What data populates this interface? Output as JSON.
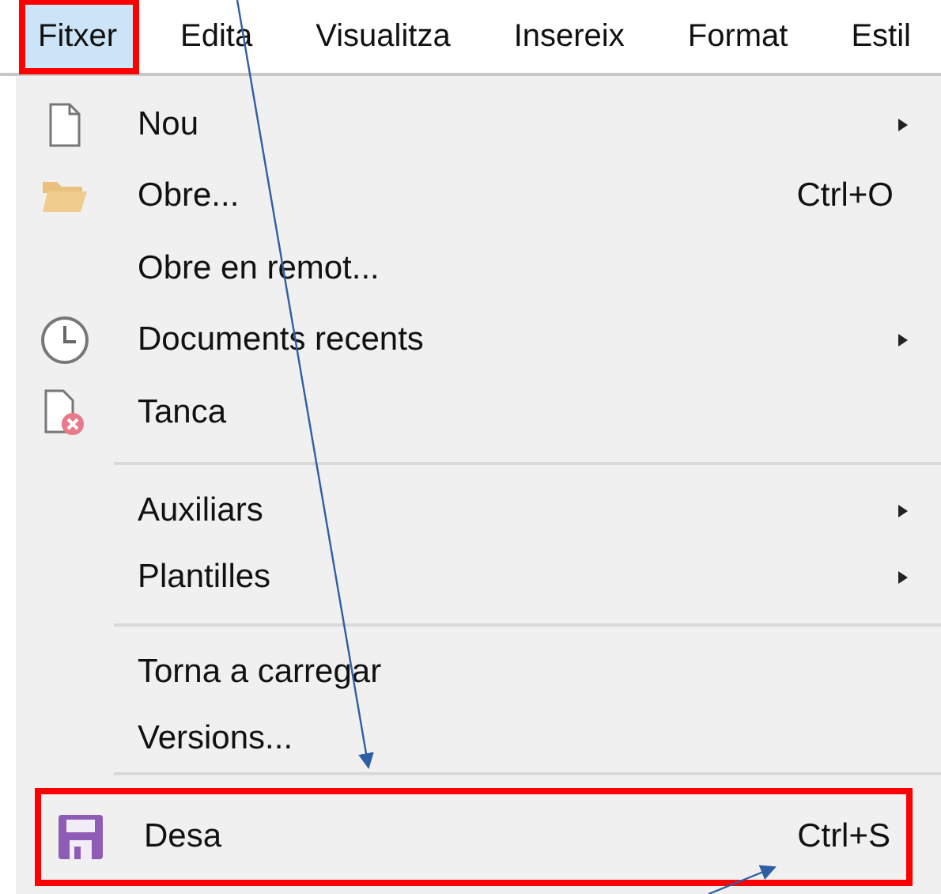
{
  "menubar": [
    {
      "label": "Fitxer",
      "selected": true,
      "highlighted": true
    },
    {
      "label": "Edita",
      "selected": false,
      "highlighted": false
    },
    {
      "label": "Visualitza",
      "selected": false,
      "highlighted": false
    },
    {
      "label": "Insereix",
      "selected": false,
      "highlighted": false
    },
    {
      "label": "Format",
      "selected": false,
      "highlighted": false
    },
    {
      "label": "Estil",
      "selected": false,
      "highlighted": false
    }
  ],
  "menu": {
    "groups": [
      [
        {
          "label": "Nou",
          "kind": "page",
          "submenu": true,
          "highlighted": false
        },
        {
          "label": "Obre...",
          "kind": "folder",
          "shortcut": "Ctrl+O",
          "submenu": false,
          "highlighted": false
        },
        {
          "label": "Obre en remot...",
          "kind": "plain",
          "submenu": false,
          "highlighted": false
        },
        {
          "label": "Documents recents",
          "kind": "clock",
          "submenu": true,
          "highlighted": false
        },
        {
          "label": "Tanca",
          "kind": "close-page",
          "submenu": false,
          "highlighted": false
        }
      ],
      [
        {
          "label": "Auxiliars",
          "kind": "plain",
          "submenu": true,
          "highlighted": false
        },
        {
          "label": "Plantilles",
          "kind": "plain",
          "submenu": true,
          "highlighted": false
        }
      ],
      [
        {
          "label": "Torna a carregar",
          "kind": "plain",
          "submenu": false,
          "highlighted": false
        },
        {
          "label": "Versions...",
          "kind": "plain",
          "submenu": false,
          "highlighted": false
        }
      ],
      [
        {
          "label": "Desa",
          "kind": "floppy",
          "shortcut": "Ctrl+S",
          "submenu": false,
          "highlighted": true,
          "arrow_to_row": true,
          "arrow_to_shortcut": true
        }
      ]
    ]
  }
}
